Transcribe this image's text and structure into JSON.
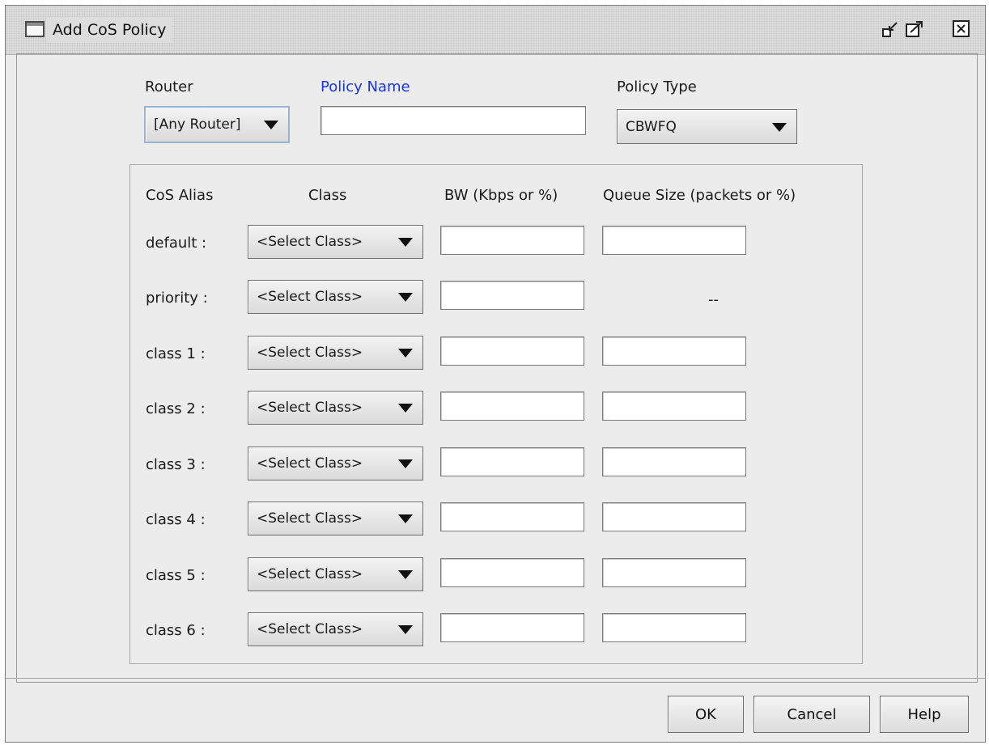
{
  "window": {
    "title": "Add CoS Policy",
    "icons": [
      "window-icon",
      "minimize-icon",
      "maximize-icon",
      "close-icon"
    ]
  },
  "header": {
    "router_label": "Router",
    "router_value": "[Any Router]",
    "policy_name_label": "Policy Name",
    "policy_name_value": "",
    "policy_type_label": "Policy Type",
    "policy_type_value": "CBWFQ"
  },
  "table": {
    "columns": [
      "CoS Alias",
      "Class",
      "BW (Kbps or %)",
      "Queue Size (packets or %)"
    ],
    "rows": [
      {
        "alias": "default :",
        "class": "<Select Class>",
        "bw": "",
        "queue": "",
        "queue_na": ""
      },
      {
        "alias": "priority :",
        "class": "<Select Class>",
        "bw": "",
        "queue": "",
        "queue_na": "--"
      },
      {
        "alias": "class 1 :",
        "class": "<Select Class>",
        "bw": "",
        "queue": "",
        "queue_na": ""
      },
      {
        "alias": "class 2 :",
        "class": "<Select Class>",
        "bw": "",
        "queue": "",
        "queue_na": ""
      },
      {
        "alias": "class 3 :",
        "class": "<Select Class>",
        "bw": "",
        "queue": "",
        "queue_na": ""
      },
      {
        "alias": "class 4 :",
        "class": "<Select Class>",
        "bw": "",
        "queue": "",
        "queue_na": ""
      },
      {
        "alias": "class 5 :",
        "class": "<Select Class>",
        "bw": "",
        "queue": "",
        "queue_na": ""
      },
      {
        "alias": "class 6 :",
        "class": "<Select Class>",
        "bw": "",
        "queue": "",
        "queue_na": ""
      }
    ]
  },
  "buttons": {
    "ok": "OK",
    "cancel": "Cancel",
    "help": "Help"
  },
  "colors": {
    "background": "#ececec",
    "required_label": "#1a35e8"
  }
}
